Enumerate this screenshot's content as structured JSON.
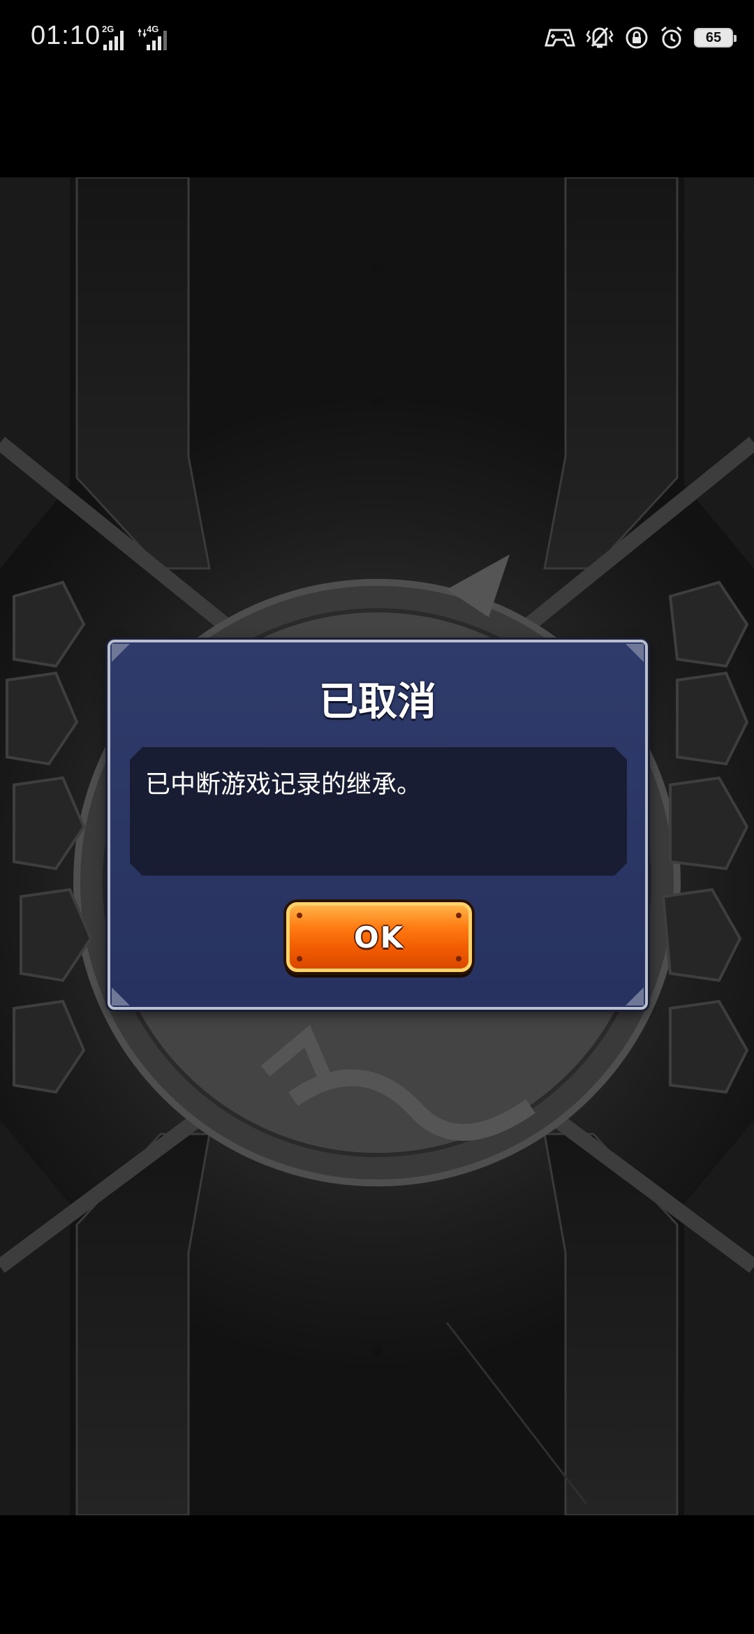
{
  "status_bar": {
    "time": "01:10",
    "sim1_network": "2G",
    "sim2_network": "4G",
    "battery_level": "65",
    "icons": [
      "gamepad-icon",
      "vibrate-icon",
      "rotation-lock-icon",
      "alarm-icon",
      "battery-icon"
    ]
  },
  "dialog": {
    "title": "已取消",
    "message": "已中断游戏记录的继承。",
    "ok_label": "OK"
  },
  "colors": {
    "dialog_bg": "#2f3b6a",
    "message_bg": "#181d33",
    "ok_button": "#f05a00"
  }
}
